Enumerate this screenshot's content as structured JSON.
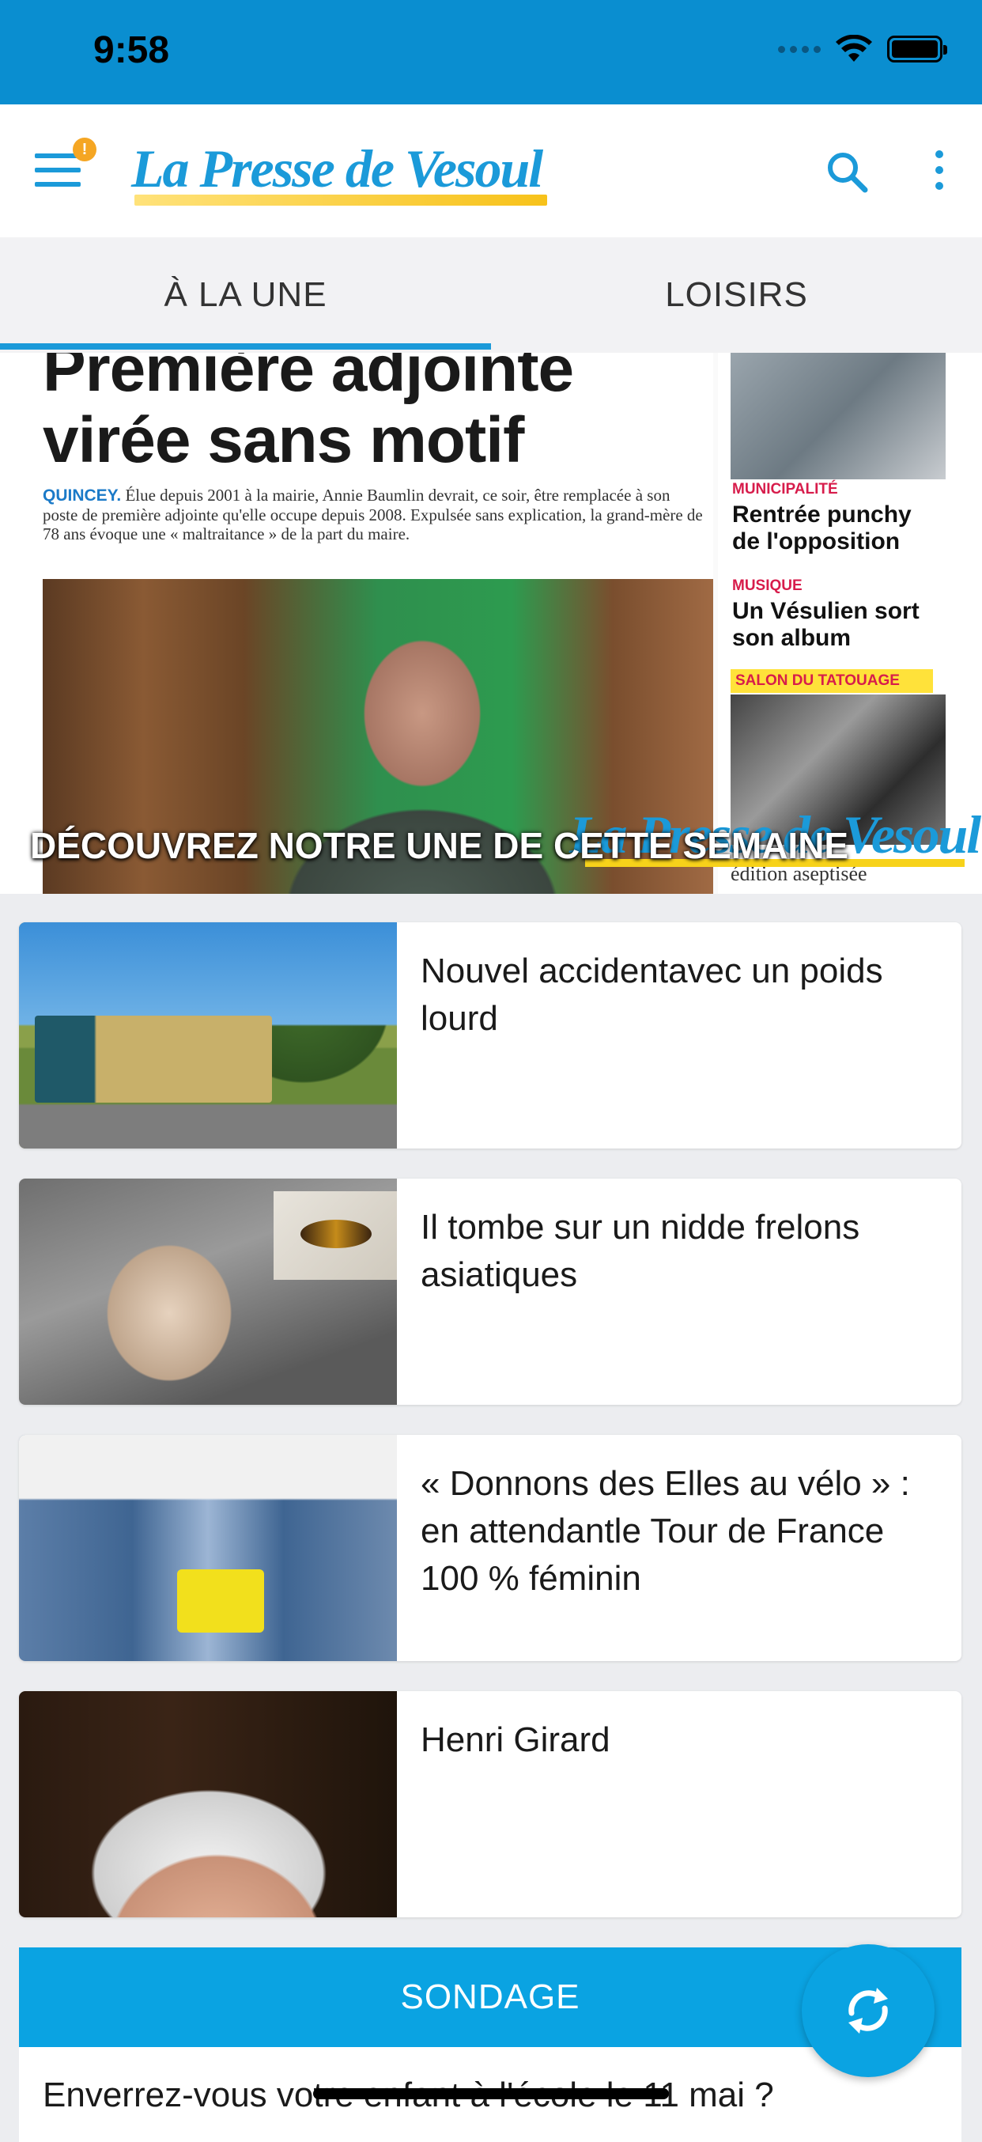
{
  "status": {
    "time": "9:58"
  },
  "header": {
    "logo": "La Presse de Vesoul",
    "menu_badge": "!"
  },
  "tabs": [
    {
      "label": "À LA UNE",
      "active": true
    },
    {
      "label": "LOISIRS",
      "active": false
    }
  ],
  "hero": {
    "headline_line1": "Première adjointe",
    "headline_line2": "virée sans motif",
    "lead_place": "QUINCEY.",
    "lead_text": "Élue depuis 2001 à la mairie, Annie Baumlin devrait, ce soir, être remplacée à son poste de première adjointe qu'elle occupe depuis 2008. Expulsée sans explication, la grand-mère de 78 ans évoque une « maltraitance » de la part du maire.",
    "side": [
      {
        "category": "MUNICIPALITÉ",
        "title": "Rentrée punchy de l'opposition"
      },
      {
        "category": "MUSIQUE",
        "title": "Un Vésulien sort son album"
      }
    ],
    "side_banner": "SALON DU TATOUAGE",
    "side_foot": "édition aseptisée",
    "caption": "DÉCOUVREZ NOTRE UNE DE CETTE SEMAINE"
  },
  "articles": [
    {
      "title": "Nouvel accidentavec un poids lourd"
    },
    {
      "title": "Il tombe sur un nidde frelons asiatiques"
    },
    {
      "title": "« Donnons des Elles au vélo » :  en attendantle Tour de France 100 % féminin"
    },
    {
      "title": "Henri Girard"
    }
  ],
  "poll": {
    "header": "SONDAGE",
    "question": "Enverrez-vous votre enfant à l'école le 11 mai ?"
  },
  "colors": {
    "brand_blue": "#1b9ad9",
    "status_bar": "#0a8ed0",
    "poll_blue": "#0aa3e2",
    "badge_orange": "#f5a623",
    "category_red": "#d71c4b"
  },
  "icons": {
    "menu": "menu-icon",
    "search": "search-icon",
    "more": "more-vertical-icon",
    "refresh": "refresh-icon"
  }
}
